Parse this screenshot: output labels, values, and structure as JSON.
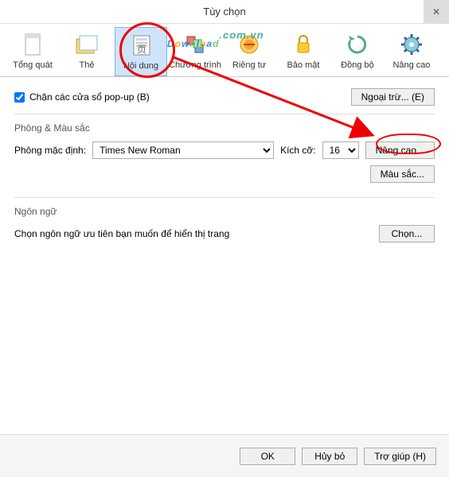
{
  "window": {
    "title": "Tùy chọn",
    "close_glyph": "✕"
  },
  "toolbar": {
    "items": [
      {
        "key": "general",
        "label": "Tổng quát"
      },
      {
        "key": "tabs",
        "label": "Thẻ"
      },
      {
        "key": "content",
        "label": "Nội dung"
      },
      {
        "key": "programs",
        "label": "Chương trình"
      },
      {
        "key": "privacy",
        "label": "Riêng tư"
      },
      {
        "key": "security",
        "label": "Bảo mật"
      },
      {
        "key": "sync",
        "label": "Đồng bộ"
      },
      {
        "key": "advanced",
        "label": "Nâng cao"
      }
    ],
    "selected": "content"
  },
  "popup": {
    "checkbox_label": "Chặn các cửa sổ pop-up (B)",
    "checked": true,
    "exceptions_btn": "Ngoại trừ... (E)"
  },
  "fonts": {
    "group_label": "Phông & Màu sắc",
    "default_font_label": "Phông mặc định:",
    "default_font_value": "Times New Roman",
    "size_label": "Kích cỡ:",
    "size_value": "16",
    "advanced_btn": "Nâng cao...",
    "colors_btn": "Màu sắc..."
  },
  "languages": {
    "group_label": "Ngôn ngữ",
    "desc": "Chọn ngôn ngữ ưu tiên bạn muốn để hiển thị trang",
    "choose_btn": "Chọn..."
  },
  "footer": {
    "ok": "OK",
    "cancel": "Hủy bỏ",
    "help": "Trợ giúp (H)"
  },
  "watermark": {
    "text": "Download",
    "suffix": ".com.vn"
  },
  "colors": {
    "accent": "#cfe4fb",
    "annot": "#e00"
  }
}
